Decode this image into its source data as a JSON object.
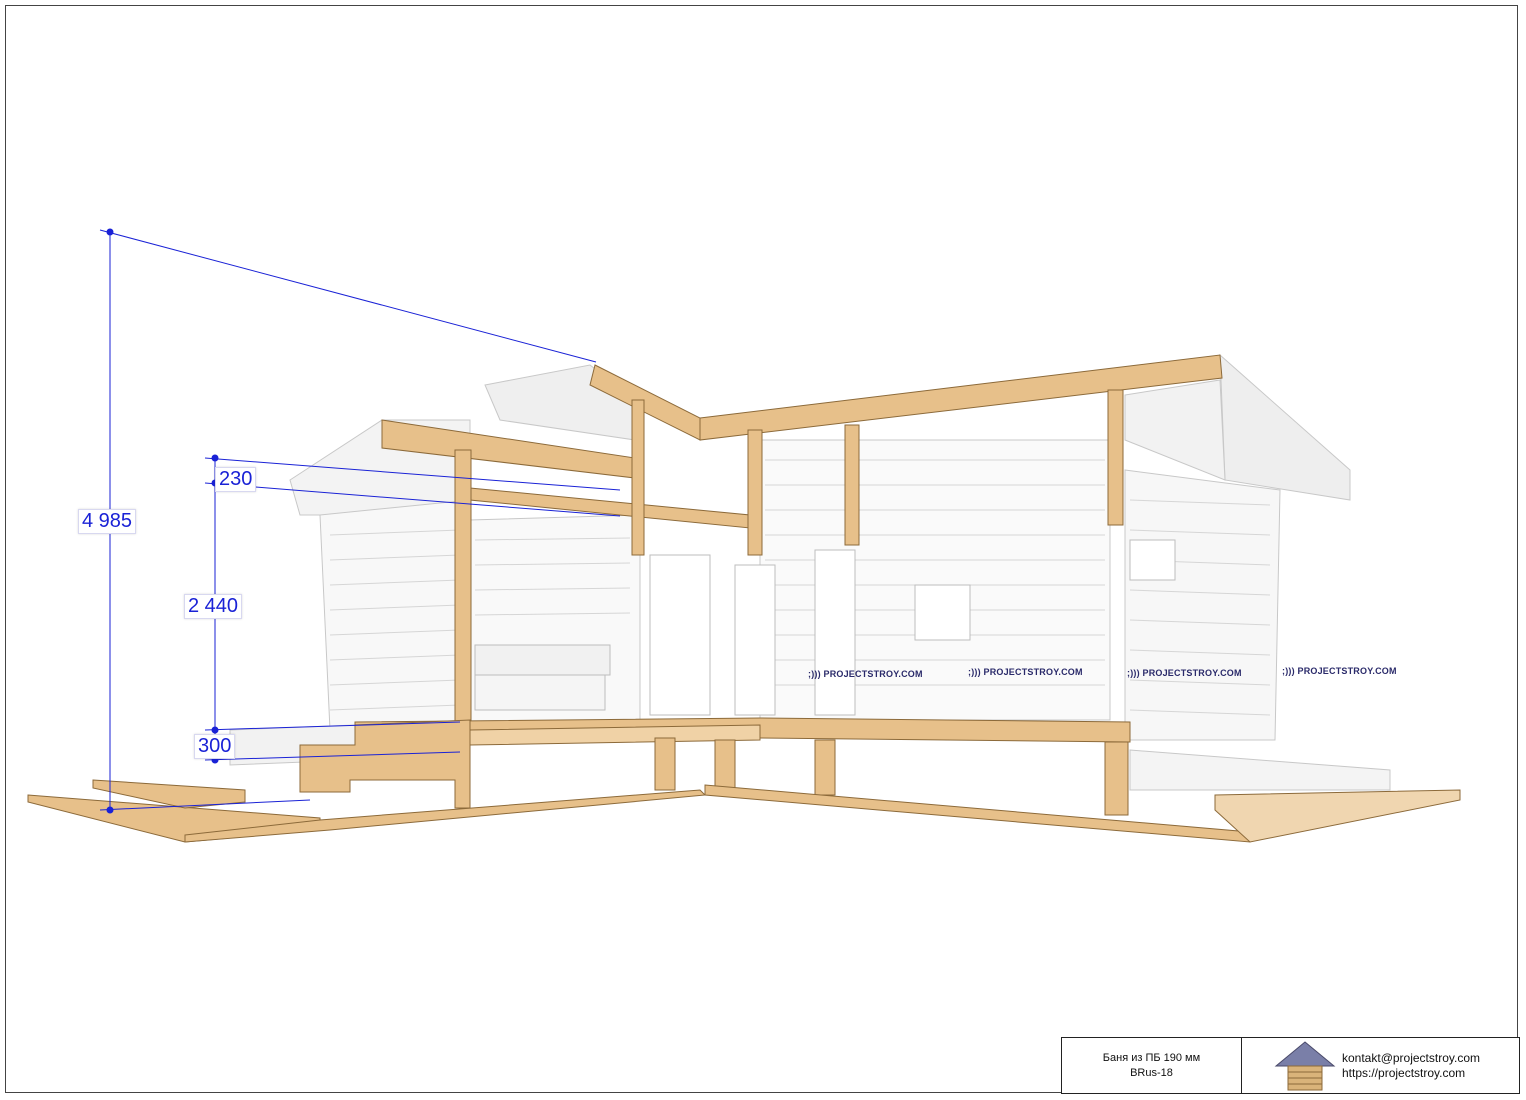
{
  "drawing": {
    "dimensions": {
      "total_height": "4 985",
      "beam_height": "230",
      "wall_height": "2 440",
      "foundation_height": "300"
    },
    "watermark": ";))) PROJECTSTROY.COM"
  },
  "title_block": {
    "project_name": "Баня из ПБ 190 мм",
    "project_code": "BRus-18",
    "email": "kontakt@projectstroy.com",
    "website": "https://projectstroy.com"
  },
  "colors": {
    "section_wood": "#e7c08a",
    "section_wood_dark": "#c99a5b",
    "dimension_line": "#1a22d6",
    "ghost_line": "#c8c8c8"
  }
}
